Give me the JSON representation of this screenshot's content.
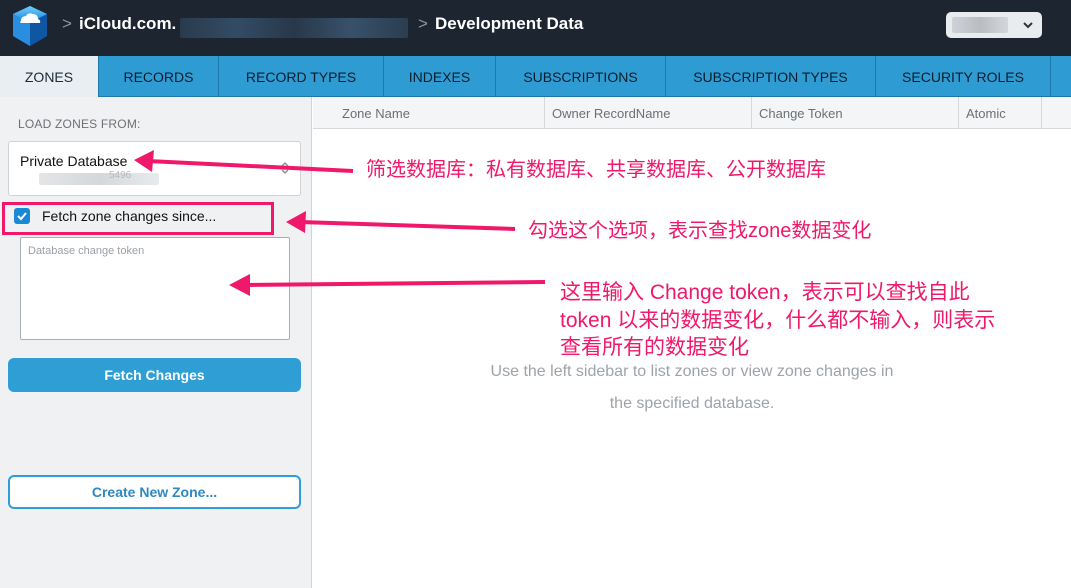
{
  "header": {
    "app_icon": "icloud-cloud-icon",
    "crumbs": [
      "iCloud.com.",
      "Development Data"
    ],
    "separator": ">",
    "account_chevron": "chevron-down-icon"
  },
  "tabs": [
    {
      "label": "ZONES",
      "active": true
    },
    {
      "label": "RECORDS",
      "active": false
    },
    {
      "label": "RECORD TYPES",
      "active": false
    },
    {
      "label": "INDEXES",
      "active": false
    },
    {
      "label": "SUBSCRIPTIONS",
      "active": false
    },
    {
      "label": "SUBSCRIPTION TYPES",
      "active": false
    },
    {
      "label": "SECURITY ROLES",
      "active": false
    }
  ],
  "sidebar": {
    "load_label": "LOAD ZONES FROM:",
    "database": {
      "value": "Private Database",
      "sub_value": "5496"
    },
    "fetch_checkbox": {
      "label": "Fetch zone changes since...",
      "checked": true
    },
    "token_field": {
      "placeholder": "Database change token",
      "value": ""
    },
    "fetch_button": "Fetch Changes",
    "create_button": "Create New Zone..."
  },
  "table": {
    "columns": [
      "Zone Name",
      "Owner RecordName",
      "Change Token",
      "Atomic"
    ],
    "empty_message_line1": "Use the left sidebar to list zones or view zone changes in",
    "empty_message_line2": "the specified database."
  },
  "annotations": {
    "database_filter": "筛选数据库：私有数据库、共享数据库、公开数据库",
    "checkbox_note": "勾选这个选项，表示查找zone数据变化",
    "token_note_1": "这里输入 Change token，表示可以查找自此",
    "token_note_2": "token 以来的数据变化，什么都不输入，则表示",
    "token_note_3": "查看所有的数据变化"
  },
  "colors": {
    "titlebar": "#1c2530",
    "tabbar": "#2f9bd3",
    "accent": "#2e9ed5",
    "annotation": "#f0186a"
  }
}
